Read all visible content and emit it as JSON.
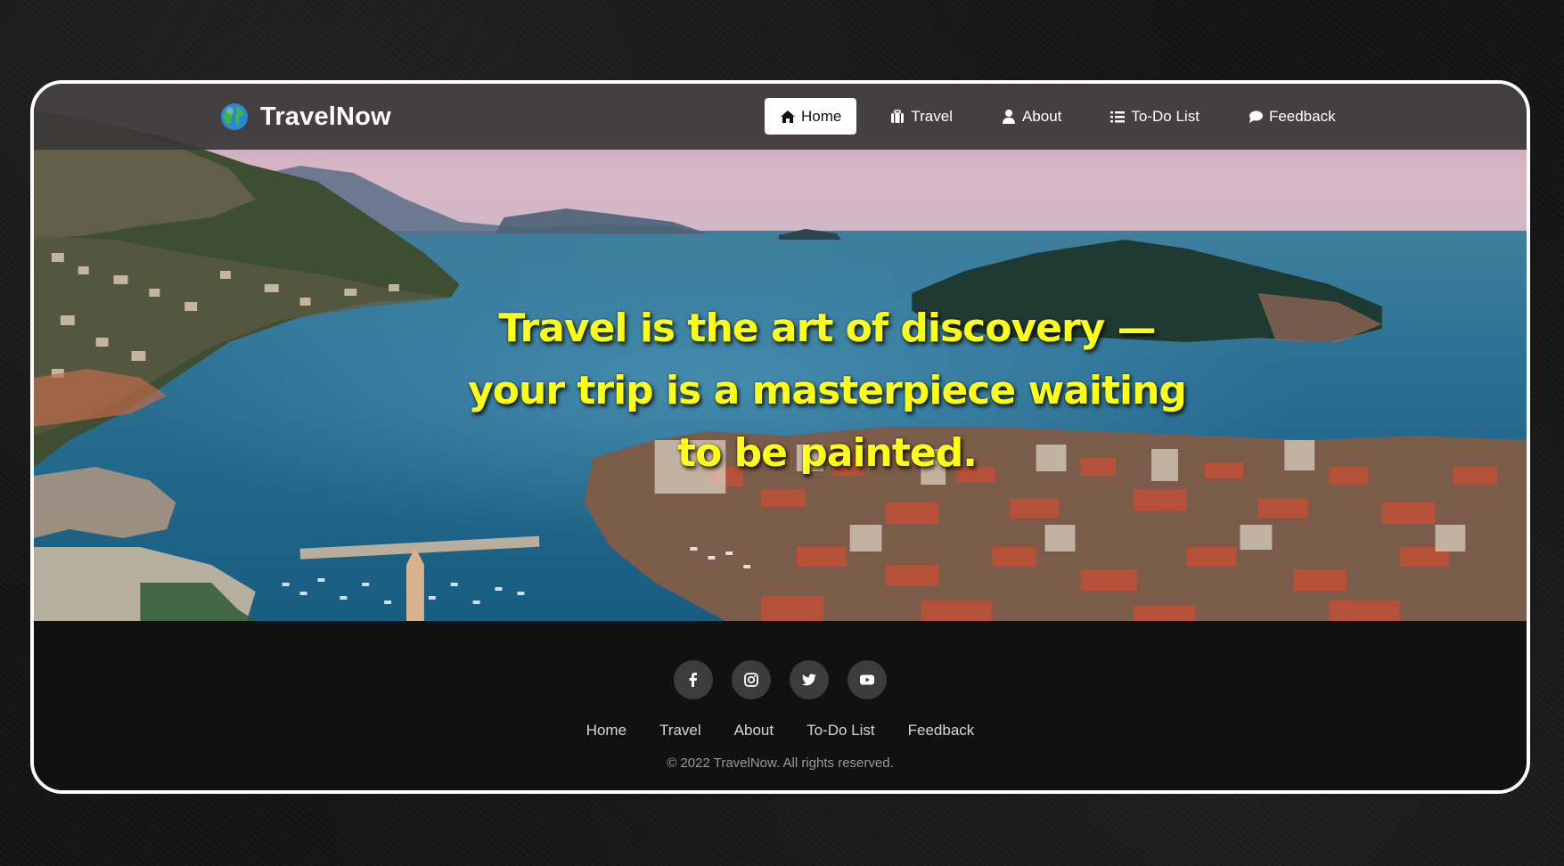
{
  "brand": {
    "name": "TravelNow",
    "logo_icon": "globe-icon"
  },
  "nav": {
    "items": [
      {
        "label": "Home",
        "icon": "home-icon",
        "active": true
      },
      {
        "label": "Travel",
        "icon": "suitcase-icon",
        "active": false
      },
      {
        "label": "About",
        "icon": "user-icon",
        "active": false
      },
      {
        "label": "To-Do List",
        "icon": "list-icon",
        "active": false
      },
      {
        "label": "Feedback",
        "icon": "comment-icon",
        "active": false
      }
    ]
  },
  "hero": {
    "quote_line1": "Travel is the art of discovery —",
    "quote_line2": "your trip is a masterpiece waiting",
    "quote_line3": "to be painted."
  },
  "footer": {
    "socials": [
      "facebook-icon",
      "instagram-icon",
      "twitter-icon",
      "youtube-icon"
    ],
    "links": [
      "Home",
      "Travel",
      "About",
      "To-Do List",
      "Feedback"
    ],
    "copyright": "© 2022 TravelNow. All rights reserved."
  },
  "colors": {
    "quote_text": "#ffff14",
    "nav_bg": "#3a3838",
    "footer_bg": "#111111",
    "frame_border": "#ffffff"
  }
}
